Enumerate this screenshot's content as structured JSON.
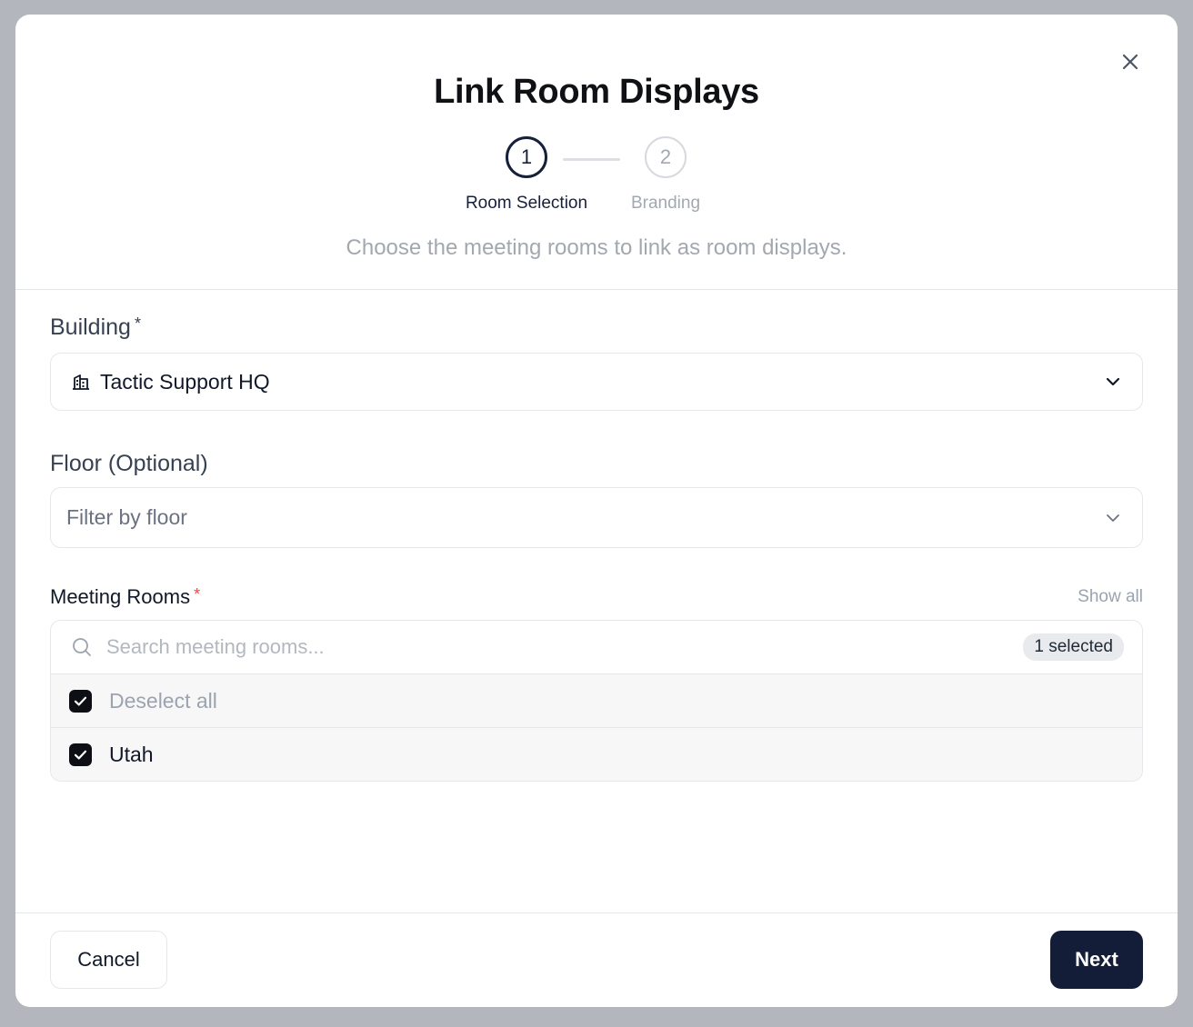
{
  "modal": {
    "title": "Link Room Displays",
    "subtitle": "Choose the meeting rooms to link as room displays."
  },
  "stepper": {
    "steps": [
      {
        "number": "1",
        "label": "Room Selection",
        "state": "active"
      },
      {
        "number": "2",
        "label": "Branding",
        "state": "inactive"
      }
    ]
  },
  "building": {
    "label": "Building",
    "required_mark": "*",
    "value": "Tactic Support HQ"
  },
  "floor": {
    "label": "Floor (Optional)",
    "placeholder": "Filter by floor"
  },
  "rooms": {
    "label": "Meeting Rooms",
    "required_mark": "*",
    "show_all": "Show all",
    "search_placeholder": "Search meeting rooms...",
    "selected_badge": "1 selected",
    "deselect_all": "Deselect all",
    "items": [
      {
        "name": "Utah",
        "checked": true
      }
    ]
  },
  "footer": {
    "cancel": "Cancel",
    "next": "Next"
  },
  "colors": {
    "primary": "#131d38",
    "required": "#ef4444",
    "muted": "#a3a8b0"
  }
}
